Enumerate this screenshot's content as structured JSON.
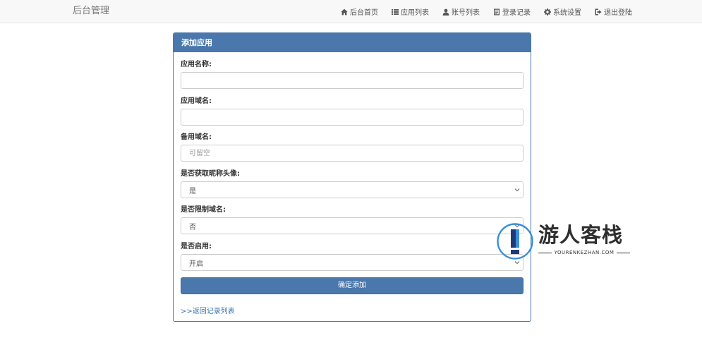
{
  "brand": "后台管理",
  "nav": [
    {
      "label": "后台首页",
      "icon": "home-icon"
    },
    {
      "label": "应用列表",
      "icon": "list-icon"
    },
    {
      "label": "账号列表",
      "icon": "user-icon"
    },
    {
      "label": "登录记录",
      "icon": "log-icon"
    },
    {
      "label": "系统设置",
      "icon": "gear-icon"
    },
    {
      "label": "退出登陆",
      "icon": "logout-icon"
    }
  ],
  "panel": {
    "title": "添加应用"
  },
  "form": {
    "app_name": {
      "label": "应用名称:",
      "value": "",
      "placeholder": ""
    },
    "app_domain": {
      "label": "应用域名:",
      "value": "",
      "placeholder": ""
    },
    "backup_domain": {
      "label": "备用域名:",
      "value": "",
      "placeholder": "可留空"
    },
    "get_avatar": {
      "label": "是否获取昵称头像:",
      "value": "是"
    },
    "restrict_domain": {
      "label": "是否限制域名:",
      "value": "否"
    },
    "enabled": {
      "label": "是否启用:",
      "value": "开启"
    },
    "submit_label": "确定添加",
    "back_link": ">>返回记录列表"
  },
  "watermark": {
    "title": "游人客栈",
    "subtitle": "YOURENKEZHAN.COM"
  },
  "colors": {
    "primary": "#4a78ad",
    "link": "#3b73ad",
    "navbar_bg": "#f8f8f8"
  }
}
